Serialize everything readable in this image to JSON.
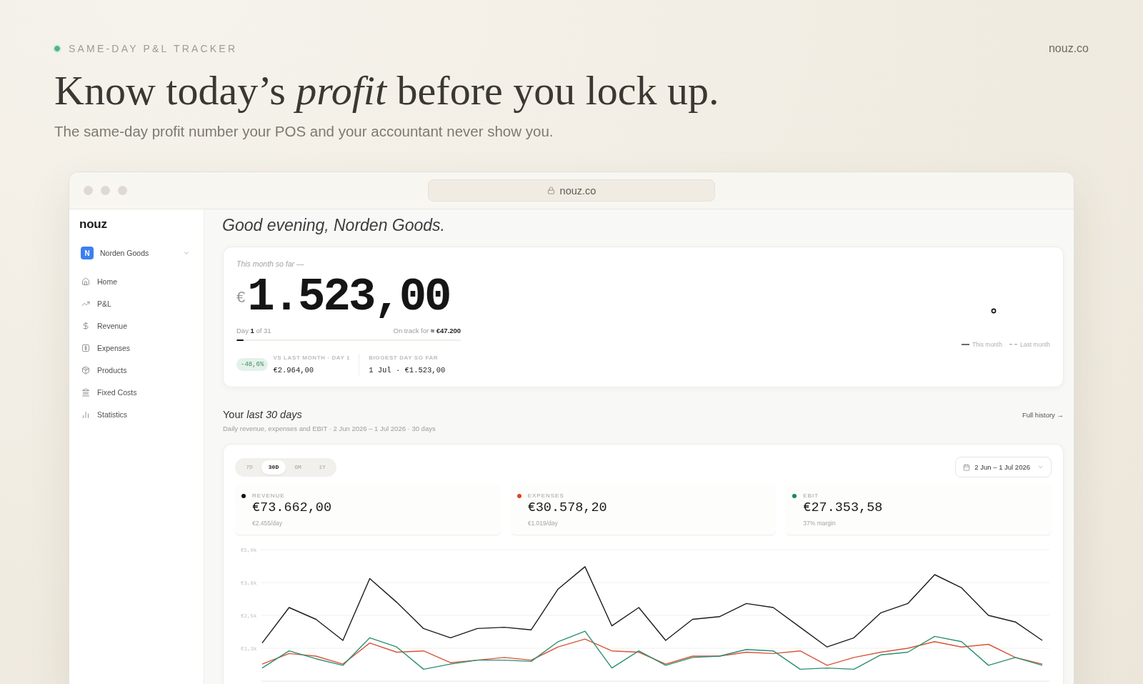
{
  "header": {
    "eyebrow": "SAME-DAY P&L TRACKER",
    "site": "nouz.co",
    "headline": "Know today’s *profit* before you lock up.",
    "subtitle": "The same-day profit number your POS and your accountant never show you."
  },
  "browser": {
    "url": "nouz.co"
  },
  "sidebar": {
    "logo": "nouz",
    "workspace": {
      "initial": "N",
      "name": "Norden Goods"
    },
    "items": [
      {
        "label": "Home"
      },
      {
        "label": "P&L"
      },
      {
        "label": "Revenue"
      },
      {
        "label": "Expenses"
      },
      {
        "label": "Products"
      },
      {
        "label": "Fixed Costs"
      },
      {
        "label": "Statistics"
      }
    ]
  },
  "greeting": "Good evening, Norden Goods.",
  "month_card": {
    "caption": "This month so far —",
    "currency": "€",
    "amount": "1.523,00",
    "day_progress": "Day **1** of 31",
    "forecast": "On track for **≈ €47.200**",
    "level": 0.032,
    "badge": "-48,6%",
    "stats": [
      {
        "label": "VS LAST MONTH · DAY 1",
        "value": "€2.964,00"
      },
      {
        "label": "BIGGEST DAY SO FAR",
        "value": "1 Jul · €1.523,00"
      }
    ],
    "legend": [
      {
        "label": "This month",
        "kind": "solid"
      },
      {
        "label": "Last month",
        "kind": "dashed"
      }
    ]
  },
  "last_30_days": {
    "title": "Your *last 30 days*",
    "subtitle": "Daily revenue, expenses and EBIT · 2 Jun 2026 – 1 Jul 2026 · 30 days",
    "link": "Full history →",
    "ranges": [
      {
        "label": "7D",
        "selected": false
      },
      {
        "label": "30D",
        "selected": true
      },
      {
        "label": "6M",
        "selected": false
      },
      {
        "label": "1Y",
        "selected": false
      }
    ],
    "date_range": "2 Jun – 1 Jul 2026",
    "kpis": [
      {
        "label": "REVENUE",
        "value": "€73.662,00",
        "note": "€2.455/day",
        "color": "#111111"
      },
      {
        "label": "EXPENSES",
        "value": "€30.578,20",
        "note": "€1.019/day",
        "color": "#e2411f"
      },
      {
        "label": "EBIT",
        "value": "€27.353,58",
        "note": "37% margin",
        "color": "#138a5e"
      }
    ],
    "chart_data": {
      "type": "line",
      "grid": true,
      "ylim": [
        0,
        5000
      ],
      "yticks": [
        {
          "value": 1250,
          "label": "€1,3k"
        },
        {
          "value": 2500,
          "label": "€2,5k"
        },
        {
          "value": 3750,
          "label": "€3,8k"
        },
        {
          "value": 5000,
          "label": "€5,0k"
        }
      ],
      "series": [
        {
          "color": "#1c1c1c",
          "values": [
            1450,
            2800,
            2350,
            1550,
            3900,
            3000,
            2000,
            1650,
            2000,
            2050,
            1950,
            3500,
            4350,
            2100,
            2800,
            1550,
            2350,
            2450,
            2950,
            2800,
            2050,
            1300,
            1650,
            2600,
            2950,
            4050,
            3550,
            2500,
            2250,
            1550
          ]
        },
        {
          "color": "#d8553a",
          "values": [
            650,
            1050,
            950,
            650,
            1450,
            1100,
            1150,
            700,
            800,
            900,
            800,
            1300,
            1600,
            1150,
            1100,
            650,
            950,
            950,
            1100,
            1050,
            1150,
            600,
            900,
            1100,
            1250,
            1500,
            1300,
            1400,
            900,
            650
          ]
        },
        {
          "color": "#2b8f73",
          "values": [
            500,
            1150,
            850,
            600,
            1650,
            1300,
            450,
            650,
            800,
            800,
            750,
            1500,
            1900,
            500,
            1150,
            600,
            900,
            950,
            1200,
            1150,
            450,
            500,
            450,
            1000,
            1100,
            1700,
            1500,
            600,
            900,
            600
          ]
        }
      ]
    }
  }
}
